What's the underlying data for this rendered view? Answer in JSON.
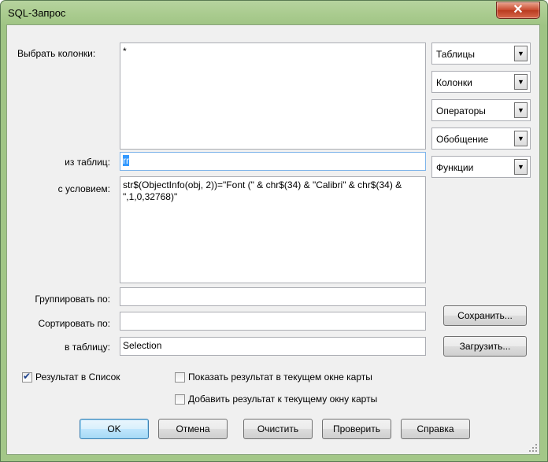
{
  "window": {
    "title": "SQL-Запрос",
    "close_label": "✕"
  },
  "labels": {
    "columns": "Выбрать колонки:",
    "tables": "из таблиц:",
    "condition": "с условием:",
    "group": "Группировать по:",
    "sort": "Сортировать по:",
    "into": "в таблицу:"
  },
  "fields": {
    "columns_value": "*",
    "tables_value": "rr",
    "condition_value": "str$(ObjectInfo(obj, 2))=\"Font (\" & chr$(34) & \"Calibri\" & chr$(34) & \",1,0,32768)\"",
    "group_value": "",
    "sort_value": "",
    "into_value": "Selection"
  },
  "dropdowns": [
    "Таблицы",
    "Колонки",
    "Операторы",
    "Обобщение",
    "Функции"
  ],
  "side_buttons": {
    "save": "Сохранить...",
    "load": "Загрузить..."
  },
  "checkboxes": {
    "result_list": {
      "label": "Результат в Список",
      "checked": true
    },
    "show_in_map": {
      "label": "Показать результат в текущем окне карты",
      "checked": false
    },
    "add_to_map": {
      "label": "Добавить результат к текущему окну карты",
      "checked": false
    }
  },
  "buttons": {
    "ok": "OK",
    "cancel": "Отмена",
    "clear": "Очистить",
    "verify": "Проверить",
    "help": "Справка"
  },
  "colors": {
    "frame": "#a3c788",
    "close": "#c8492d",
    "selection": "#3399ff"
  }
}
